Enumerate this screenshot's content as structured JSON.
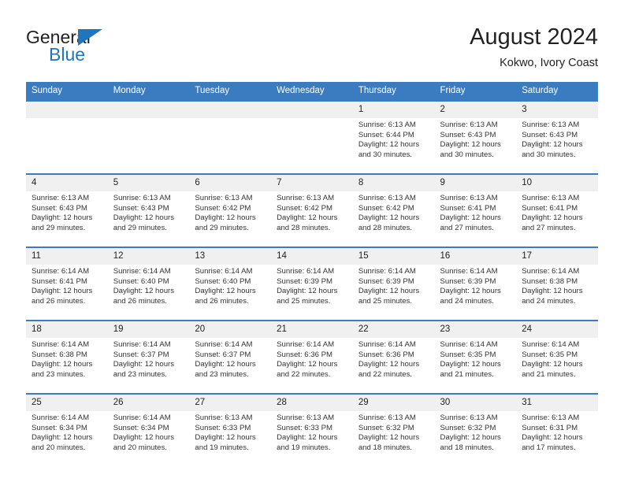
{
  "brand": {
    "name_top": "General",
    "name_bottom": "Blue",
    "triangle_color": "#1f76bc"
  },
  "header": {
    "title": "August 2024",
    "subtitle": "Kokwo, Ivory Coast"
  },
  "theme": {
    "header_blue": "#3a7cbf",
    "daynum_band": "#f0f0f0",
    "text": "#333333"
  },
  "calendar": {
    "weekday_headers": [
      "Sunday",
      "Monday",
      "Tuesday",
      "Wednesday",
      "Thursday",
      "Friday",
      "Saturday"
    ],
    "weeks": [
      [
        {
          "day": "",
          "blank": true,
          "sunrise": "",
          "sunset": "",
          "daylight": ""
        },
        {
          "day": "",
          "blank": true,
          "sunrise": "",
          "sunset": "",
          "daylight": ""
        },
        {
          "day": "",
          "blank": true,
          "sunrise": "",
          "sunset": "",
          "daylight": ""
        },
        {
          "day": "",
          "blank": true,
          "sunrise": "",
          "sunset": "",
          "daylight": ""
        },
        {
          "day": "1",
          "sunrise": "Sunrise: 6:13 AM",
          "sunset": "Sunset: 6:44 PM",
          "daylight": "Daylight: 12 hours and 30 minutes."
        },
        {
          "day": "2",
          "sunrise": "Sunrise: 6:13 AM",
          "sunset": "Sunset: 6:43 PM",
          "daylight": "Daylight: 12 hours and 30 minutes."
        },
        {
          "day": "3",
          "sunrise": "Sunrise: 6:13 AM",
          "sunset": "Sunset: 6:43 PM",
          "daylight": "Daylight: 12 hours and 30 minutes."
        }
      ],
      [
        {
          "day": "4",
          "sunrise": "Sunrise: 6:13 AM",
          "sunset": "Sunset: 6:43 PM",
          "daylight": "Daylight: 12 hours and 29 minutes."
        },
        {
          "day": "5",
          "sunrise": "Sunrise: 6:13 AM",
          "sunset": "Sunset: 6:43 PM",
          "daylight": "Daylight: 12 hours and 29 minutes."
        },
        {
          "day": "6",
          "sunrise": "Sunrise: 6:13 AM",
          "sunset": "Sunset: 6:42 PM",
          "daylight": "Daylight: 12 hours and 29 minutes."
        },
        {
          "day": "7",
          "sunrise": "Sunrise: 6:13 AM",
          "sunset": "Sunset: 6:42 PM",
          "daylight": "Daylight: 12 hours and 28 minutes."
        },
        {
          "day": "8",
          "sunrise": "Sunrise: 6:13 AM",
          "sunset": "Sunset: 6:42 PM",
          "daylight": "Daylight: 12 hours and 28 minutes."
        },
        {
          "day": "9",
          "sunrise": "Sunrise: 6:13 AM",
          "sunset": "Sunset: 6:41 PM",
          "daylight": "Daylight: 12 hours and 27 minutes."
        },
        {
          "day": "10",
          "sunrise": "Sunrise: 6:13 AM",
          "sunset": "Sunset: 6:41 PM",
          "daylight": "Daylight: 12 hours and 27 minutes."
        }
      ],
      [
        {
          "day": "11",
          "sunrise": "Sunrise: 6:14 AM",
          "sunset": "Sunset: 6:41 PM",
          "daylight": "Daylight: 12 hours and 26 minutes."
        },
        {
          "day": "12",
          "sunrise": "Sunrise: 6:14 AM",
          "sunset": "Sunset: 6:40 PM",
          "daylight": "Daylight: 12 hours and 26 minutes."
        },
        {
          "day": "13",
          "sunrise": "Sunrise: 6:14 AM",
          "sunset": "Sunset: 6:40 PM",
          "daylight": "Daylight: 12 hours and 26 minutes."
        },
        {
          "day": "14",
          "sunrise": "Sunrise: 6:14 AM",
          "sunset": "Sunset: 6:39 PM",
          "daylight": "Daylight: 12 hours and 25 minutes."
        },
        {
          "day": "15",
          "sunrise": "Sunrise: 6:14 AM",
          "sunset": "Sunset: 6:39 PM",
          "daylight": "Daylight: 12 hours and 25 minutes."
        },
        {
          "day": "16",
          "sunrise": "Sunrise: 6:14 AM",
          "sunset": "Sunset: 6:39 PM",
          "daylight": "Daylight: 12 hours and 24 minutes."
        },
        {
          "day": "17",
          "sunrise": "Sunrise: 6:14 AM",
          "sunset": "Sunset: 6:38 PM",
          "daylight": "Daylight: 12 hours and 24 minutes."
        }
      ],
      [
        {
          "day": "18",
          "sunrise": "Sunrise: 6:14 AM",
          "sunset": "Sunset: 6:38 PM",
          "daylight": "Daylight: 12 hours and 23 minutes."
        },
        {
          "day": "19",
          "sunrise": "Sunrise: 6:14 AM",
          "sunset": "Sunset: 6:37 PM",
          "daylight": "Daylight: 12 hours and 23 minutes."
        },
        {
          "day": "20",
          "sunrise": "Sunrise: 6:14 AM",
          "sunset": "Sunset: 6:37 PM",
          "daylight": "Daylight: 12 hours and 23 minutes."
        },
        {
          "day": "21",
          "sunrise": "Sunrise: 6:14 AM",
          "sunset": "Sunset: 6:36 PM",
          "daylight": "Daylight: 12 hours and 22 minutes."
        },
        {
          "day": "22",
          "sunrise": "Sunrise: 6:14 AM",
          "sunset": "Sunset: 6:36 PM",
          "daylight": "Daylight: 12 hours and 22 minutes."
        },
        {
          "day": "23",
          "sunrise": "Sunrise: 6:14 AM",
          "sunset": "Sunset: 6:35 PM",
          "daylight": "Daylight: 12 hours and 21 minutes."
        },
        {
          "day": "24",
          "sunrise": "Sunrise: 6:14 AM",
          "sunset": "Sunset: 6:35 PM",
          "daylight": "Daylight: 12 hours and 21 minutes."
        }
      ],
      [
        {
          "day": "25",
          "sunrise": "Sunrise: 6:14 AM",
          "sunset": "Sunset: 6:34 PM",
          "daylight": "Daylight: 12 hours and 20 minutes."
        },
        {
          "day": "26",
          "sunrise": "Sunrise: 6:14 AM",
          "sunset": "Sunset: 6:34 PM",
          "daylight": "Daylight: 12 hours and 20 minutes."
        },
        {
          "day": "27",
          "sunrise": "Sunrise: 6:13 AM",
          "sunset": "Sunset: 6:33 PM",
          "daylight": "Daylight: 12 hours and 19 minutes."
        },
        {
          "day": "28",
          "sunrise": "Sunrise: 6:13 AM",
          "sunset": "Sunset: 6:33 PM",
          "daylight": "Daylight: 12 hours and 19 minutes."
        },
        {
          "day": "29",
          "sunrise": "Sunrise: 6:13 AM",
          "sunset": "Sunset: 6:32 PM",
          "daylight": "Daylight: 12 hours and 18 minutes."
        },
        {
          "day": "30",
          "sunrise": "Sunrise: 6:13 AM",
          "sunset": "Sunset: 6:32 PM",
          "daylight": "Daylight: 12 hours and 18 minutes."
        },
        {
          "day": "31",
          "sunrise": "Sunrise: 6:13 AM",
          "sunset": "Sunset: 6:31 PM",
          "daylight": "Daylight: 12 hours and 17 minutes."
        }
      ]
    ]
  }
}
